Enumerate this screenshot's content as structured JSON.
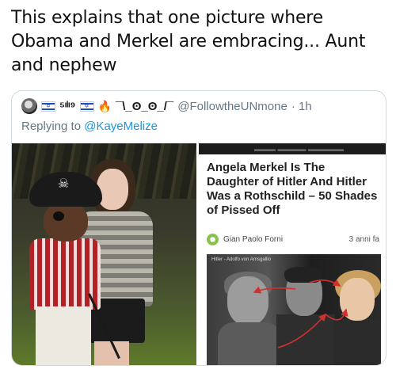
{
  "caption": "This explains that one picture where Obama and Merkel are embracing... Aunt and nephew",
  "tweet": {
    "display_name": "⁵ᶦˡᶦ⁹",
    "decor_suffix": "¯\\_ʘ_ʘ_/¯",
    "handle": "@FollowtheUNmone",
    "time": "· 1h",
    "reply_prefix": "Replying to",
    "reply_to": "@KayeMelize"
  },
  "article": {
    "title": "Angela Merkel Is The Daughter of Hitler And Hitler Was a Rothschild – 50 Shades of Pissed Off",
    "author": "Gian Paolo Forni",
    "date": "3 anni fa",
    "photo_caption": "Hitler - Adolfo von Arnsgallio"
  },
  "colors": {
    "link": "#1b95e0",
    "muted": "#657786",
    "border": "#cfd9de",
    "arrow": "#d32f2f"
  },
  "icons": [
    "avatar",
    "israel-flag-icon",
    "fire-icon",
    "author-icon"
  ]
}
